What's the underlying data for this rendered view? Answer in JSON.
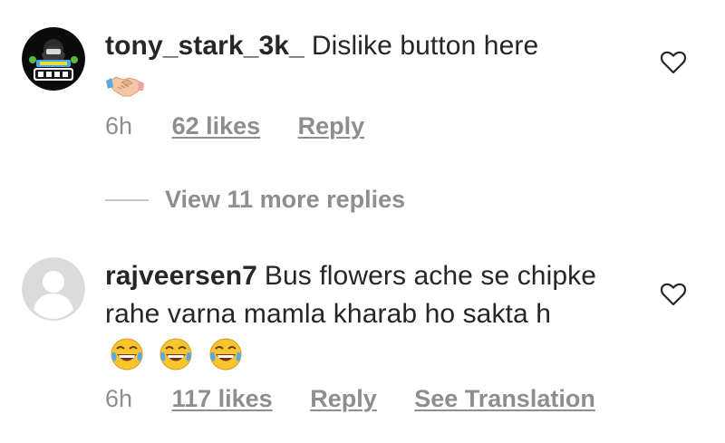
{
  "comments": [
    {
      "username": "tony_stark_3k_",
      "text": "Dislike button here",
      "emoji": "handshake-icon",
      "time": "6h",
      "likes": "62 likes",
      "reply": "Reply",
      "avatar": "gaming-logo-avatar"
    },
    {
      "username": "rajveersen7",
      "text": "Bus flowers ache se chipke rahe varna mamla kharab ho sakta h",
      "emoji": "laugh-icon",
      "time": "6h",
      "likes": "117 likes",
      "reply": "Reply",
      "translation": "See Translation",
      "avatar": "default-avatar"
    }
  ],
  "view_replies": "View 11 more replies",
  "colors": {
    "text": "#262626",
    "secondary": "#8e8e8e",
    "divider": "#c7c7c7"
  }
}
